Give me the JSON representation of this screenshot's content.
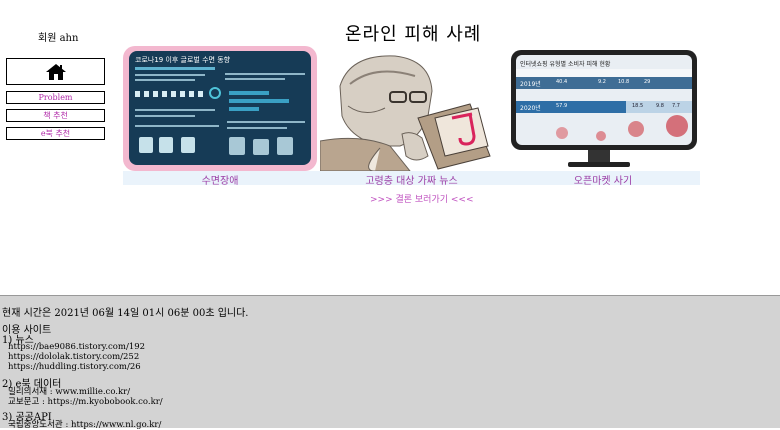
{
  "header": {
    "user": "회원 ahn",
    "title": "온라인 피해 사례"
  },
  "nav": {
    "home_icon": "home-icon",
    "items": [
      "Problem",
      "책 추천",
      "e북 추천"
    ]
  },
  "cards": [
    {
      "caption": "수면장애",
      "image_title": "코로나19 이후 글로벌 수면 동향"
    },
    {
      "caption": "고령층 대상 가짜 뉴스"
    },
    {
      "caption": "오픈마켓 사기",
      "image_title": "인터넷쇼핑 유형별 소비자 피해 현황",
      "rows": [
        {
          "year": "2019년",
          "values": [
            "40.4",
            "9.2",
            "10.8",
            "29"
          ]
        },
        {
          "year": "2020년",
          "values": [
            "57.9",
            "18.5",
            "9.8",
            "7.7"
          ]
        }
      ]
    }
  ],
  "more_link": ">>> 결론 보러가기 <<<",
  "footer": {
    "time": "현재 시간은 2021년 06월 14일 01시 06분 00초 입니다.",
    "sites_heading": "이용 사이트",
    "news_heading": "1) 뉴스",
    "news_links": [
      "https://bae9086.tistory.com/192",
      "https://dololak.tistory.com/252",
      "https://huddling.tistory.com/26"
    ],
    "ebook_heading": "2) e북 데이터",
    "ebook_links": [
      "밀리의서재 : www.millie.co.kr/",
      "교보문고 : https://m.kyobobook.co.kr/"
    ],
    "api_heading": "3) 공공API",
    "api_links": [
      "국립중앙도서관 : https://www.nl.go.kr/"
    ]
  }
}
